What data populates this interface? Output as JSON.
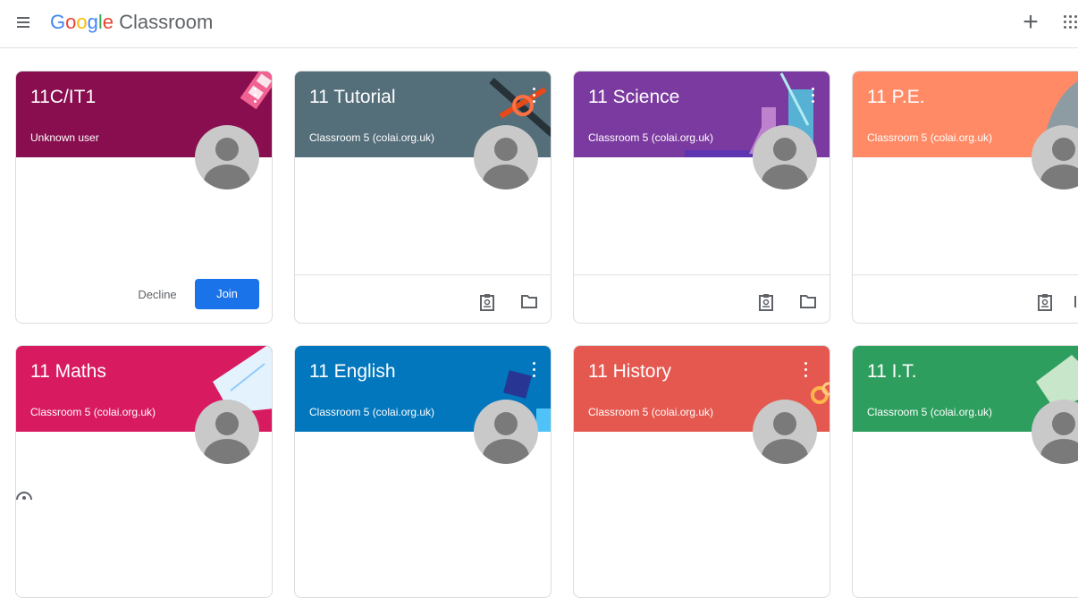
{
  "header": {
    "logo_letters": [
      {
        "ch": "G",
        "color": "#4285f4"
      },
      {
        "ch": "o",
        "color": "#ea4335"
      },
      {
        "ch": "o",
        "color": "#fbbc05"
      },
      {
        "ch": "g",
        "color": "#4285f4"
      },
      {
        "ch": "l",
        "color": "#34a853"
      },
      {
        "ch": "e",
        "color": "#ea4335"
      }
    ],
    "product": "Classroom",
    "create_label": "+",
    "icons": {
      "menu": "menu-icon",
      "apps": "apps-grid-icon"
    }
  },
  "classes": [
    {
      "title": "11C/IT1",
      "subtitle": "Unknown user",
      "color": "#880e4f"
    },
    {
      "title": "11 Tutorial",
      "subtitle": "Classroom 5 (colai.org.uk)",
      "color": "#546e7a"
    },
    {
      "title": "11 Science",
      "subtitle": "Classroom 5 (colai.org.uk)",
      "color": "#7b3aa0"
    },
    {
      "title": "11 P.E.",
      "subtitle": "Classroom 5 (colai.org.uk)",
      "color": "#ff8a65"
    },
    {
      "title": "11 Maths",
      "subtitle": "Classroom 5 (colai.org.uk)",
      "color": "#d81b60"
    },
    {
      "title": "11 English",
      "subtitle": "Classroom 5 (colai.org.uk)",
      "color": "#0277bd"
    },
    {
      "title": "11 History",
      "subtitle": "Classroom 5 (colai.org.uk)",
      "color": "#e4584f"
    },
    {
      "title": "11 I.T.",
      "subtitle": "Classroom 5 (colai.org.uk)",
      "color": "#2e9e5f"
    }
  ],
  "invite": {
    "decline_label": "Decline",
    "join_label": "Join",
    "accent": "#1a73e8"
  }
}
